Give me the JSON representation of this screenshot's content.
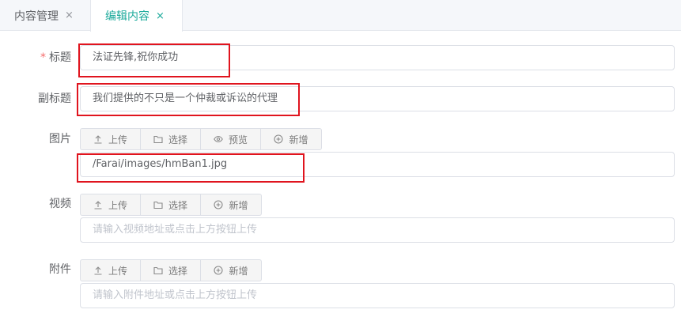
{
  "tabs": [
    {
      "label": "内容管理",
      "close": "×"
    },
    {
      "label": "编辑内容",
      "close": "×"
    }
  ],
  "form": {
    "required_mark": "*",
    "title": {
      "label": "标题",
      "value": "法证先锋,祝你成功"
    },
    "subtitle": {
      "label": "副标题",
      "value": "我们提供的不只是一个仲裁或诉讼的代理"
    },
    "image": {
      "label": "图片",
      "buttons": {
        "upload": "上传",
        "select": "选择",
        "preview": "预览",
        "add": "新增"
      },
      "value": "/Farai/images/hmBan1.jpg"
    },
    "video": {
      "label": "视频",
      "buttons": {
        "upload": "上传",
        "select": "选择",
        "add": "新增"
      },
      "placeholder": "请输入视频地址或点击上方按钮上传"
    },
    "attachment": {
      "label": "附件",
      "buttons": {
        "upload": "上传",
        "select": "选择",
        "add": "新增"
      },
      "placeholder": "请输入附件地址或点击上方按钮上传"
    }
  },
  "colors": {
    "accent": "#1aa99a",
    "highlight": "#e0141e",
    "required": "#f56c6c"
  }
}
